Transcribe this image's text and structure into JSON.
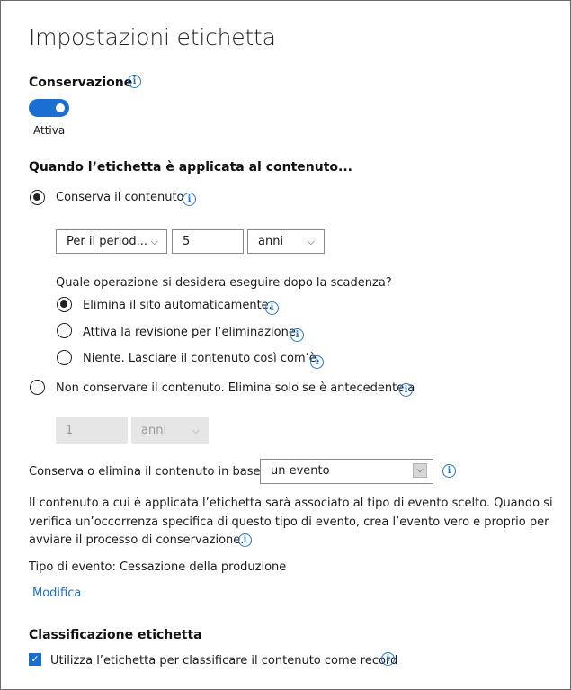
{
  "title": "Impostazioni etichetta",
  "retention": {
    "label": "Conservazione",
    "toggle_state": "Attiva",
    "on": true
  },
  "when_applied": {
    "heading": "Quando l’etichetta è applicata al contenuto...",
    "retain_option": "Conserva il contenuto",
    "period_select": "Per il period...",
    "period_value": "5",
    "unit_select": "anni",
    "after_question": "Quale operazione si desidera eseguire dopo la scadenza?",
    "after_options": [
      {
        "label": "Elimina il sito automaticamente.",
        "selected": true
      },
      {
        "label": "Attiva la revisione per l’eliminazione.",
        "selected": false
      },
      {
        "label": "Niente. Lasciare il contenuto così com’è.",
        "selected": false
      }
    ],
    "dont_retain_option": "Non conservare il contenuto. Elimina solo se è antecedente a",
    "dont_retain_value": "1",
    "dont_retain_unit": "anni"
  },
  "based_on": {
    "label": "Conserva o elimina il contenuto in base a",
    "value": "un evento"
  },
  "description": [
    "Il contenuto a cui è applicata l’etichetta sarà associato al tipo di evento scelto. Quando si",
    " verifica un’occorrenza specifica di questo tipo di evento, crea l’evento vero e proprio per",
    "avviare il processo di conservazione."
  ],
  "event_type": "Tipo di evento: Cessazione della produzione",
  "edit_link": "Modifica",
  "classification": {
    "heading": "Classificazione etichetta",
    "checkbox_label": "Utilizza l’etichetta per classificare il contenuto come record",
    "checked": true
  },
  "colors": {
    "accent": "#1a6fd0",
    "link": "#1f6fc1",
    "disabled_bg": "#e6e6e6"
  }
}
